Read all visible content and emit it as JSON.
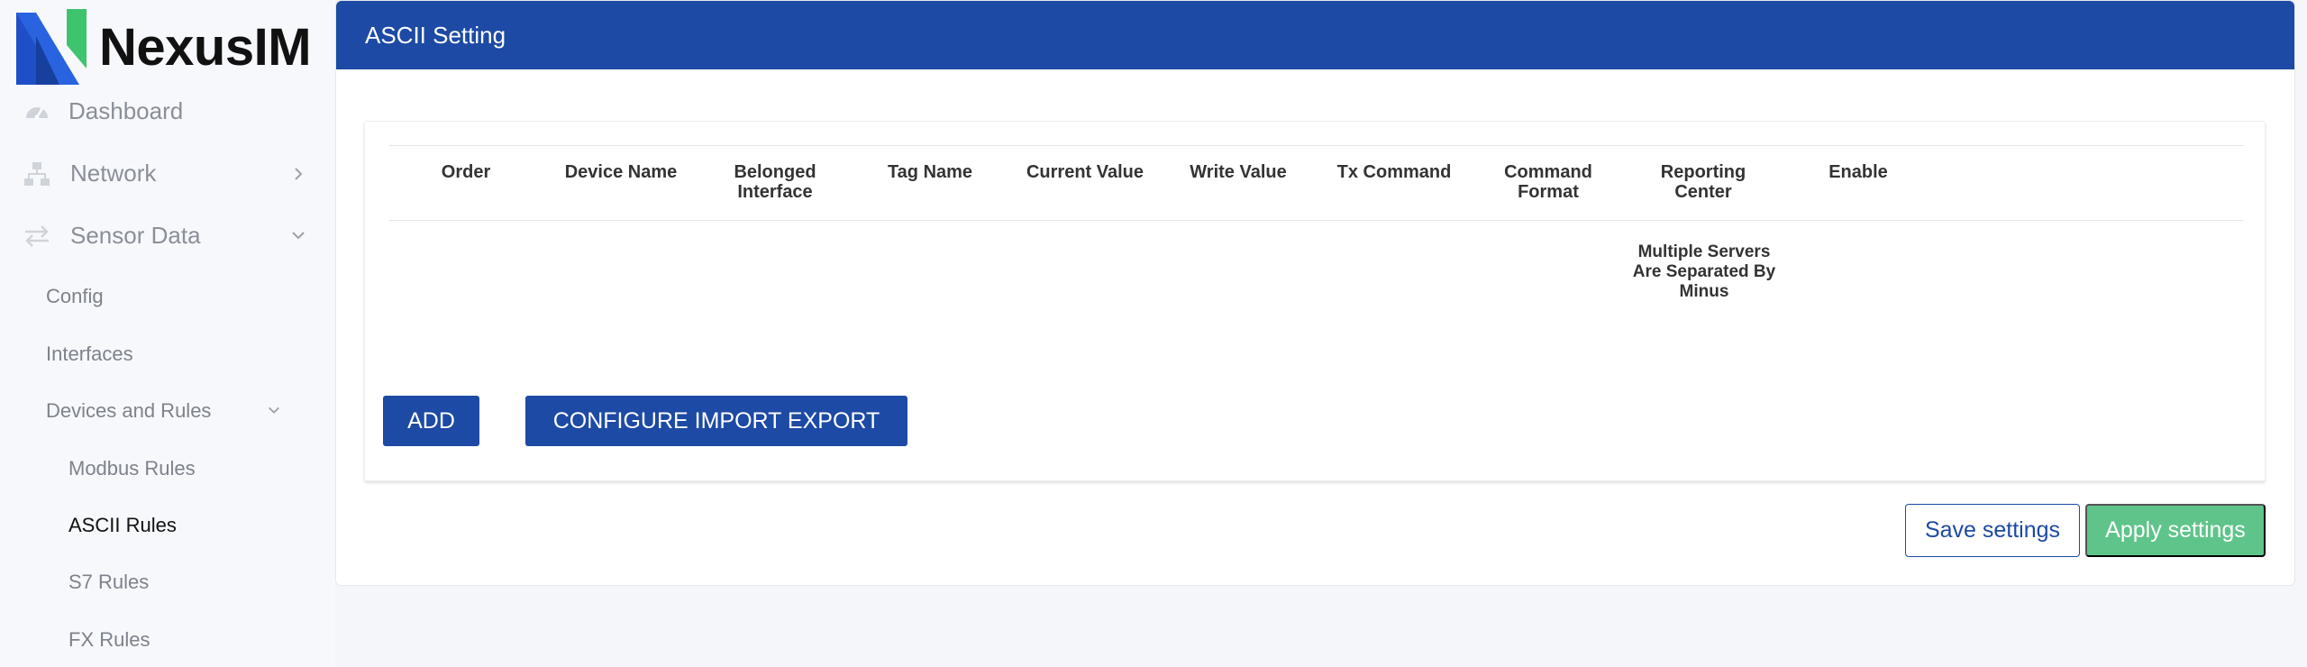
{
  "brand": {
    "name": "NexusIM",
    "colors": {
      "primary": "#1d4aa5",
      "accent": "#5fc48a",
      "logo_blue": "#1e4fc7",
      "logo_green": "#3ec46d"
    }
  },
  "sidebar": {
    "dashboard": {
      "label": "Dashboard",
      "icon": "dashboard-gauge-icon"
    },
    "network": {
      "label": "Network",
      "icon": "network-icon"
    },
    "sensor_data": {
      "label": "Sensor Data",
      "icon": "transfer-arrows-icon"
    },
    "config": "Config",
    "interfaces": "Interfaces",
    "devices_and_rules": "Devices and Rules",
    "modbus_rules": "Modbus Rules",
    "ascii_rules": "ASCII Rules",
    "s7_rules": "S7 Rules",
    "fx_rules": "FX Rules"
  },
  "page": {
    "title": "ASCII Setting",
    "columns": [
      "Order",
      "Device Name",
      "Belonged Interface",
      "Tag Name",
      "Current Value",
      "Write Value",
      "Tx Command",
      "Command Format",
      "Reporting Center",
      "Enable"
    ],
    "reporting_note": "Multiple Servers Are Separated By Minus",
    "add_label": "ADD",
    "import_export_label": "CONFIGURE IMPORT EXPORT",
    "save_label": "Save settings",
    "apply_label": "Apply settings"
  }
}
